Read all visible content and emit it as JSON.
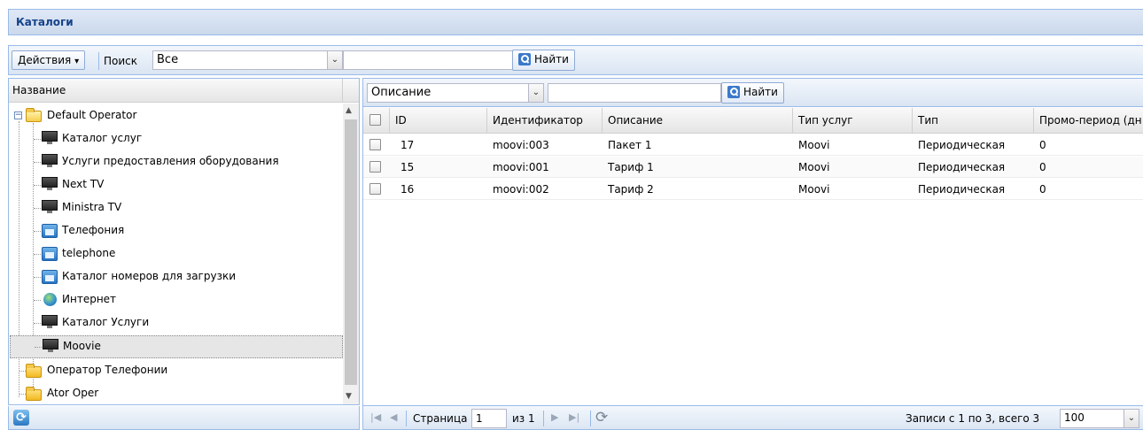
{
  "panel": {
    "title": "Каталоги"
  },
  "toolbar": {
    "actions_label": "Действия",
    "search_label": "Поиск",
    "search_scope": "Все",
    "search_value": "",
    "find_label": "Найти"
  },
  "tree": {
    "column_header": "Название",
    "items": [
      {
        "label": "Default Operator",
        "type": "folder-open",
        "level": 0
      },
      {
        "label": "Каталог услуг",
        "type": "tv",
        "level": 1
      },
      {
        "label": "Услуги предоставления оборудования",
        "type": "tv",
        "level": 1
      },
      {
        "label": "Next TV",
        "type": "tv",
        "level": 1
      },
      {
        "label": "Ministra TV",
        "type": "tv",
        "level": 1
      },
      {
        "label": "Телефония",
        "type": "phone",
        "level": 1
      },
      {
        "label": "telephone",
        "type": "phone",
        "level": 1
      },
      {
        "label": "Каталог номеров для загрузки",
        "type": "phone",
        "level": 1
      },
      {
        "label": "Интернет",
        "type": "globe",
        "level": 1
      },
      {
        "label": "Каталог Услуги",
        "type": "tv",
        "level": 1
      },
      {
        "label": "Moovie",
        "type": "tv",
        "level": 1,
        "selected": true
      },
      {
        "label": "Оператор Телефонии",
        "type": "folder",
        "level": 0
      },
      {
        "label": "Ator Oper",
        "type": "folder",
        "level": 0
      }
    ]
  },
  "grid": {
    "filter_field": "Описание",
    "filter_value": "",
    "find_label": "Найти",
    "columns": [
      "ID",
      "Идентификатор",
      "Описание",
      "Тип услуг",
      "Тип",
      "Промо-период (дн"
    ],
    "rows": [
      {
        "id": "17",
        "identifier": "moovi:003",
        "description": "Пакет 1",
        "service_type": "Moovi",
        "type": "Периодическая",
        "promo": "0"
      },
      {
        "id": "15",
        "identifier": "moovi:001",
        "description": "Тариф 1",
        "service_type": "Moovi",
        "type": "Периодическая",
        "promo": "0"
      },
      {
        "id": "16",
        "identifier": "moovi:002",
        "description": "Тариф 2",
        "service_type": "Moovi",
        "type": "Периодическая",
        "promo": "0"
      }
    ],
    "pager": {
      "page_label": "Страница",
      "page_value": "1",
      "of_label": "из 1",
      "records_label": "Записи с 1 по 3, всего 3",
      "page_size": "100"
    }
  },
  "icons": {
    "dropdown": "▾",
    "combo_arrow": "⌄",
    "first": "|◀",
    "prev": "◀",
    "next": "▶",
    "last": "▶|",
    "refresh": "⟳",
    "scroll_up": "▲",
    "scroll_down": "▼",
    "minus": "−"
  }
}
